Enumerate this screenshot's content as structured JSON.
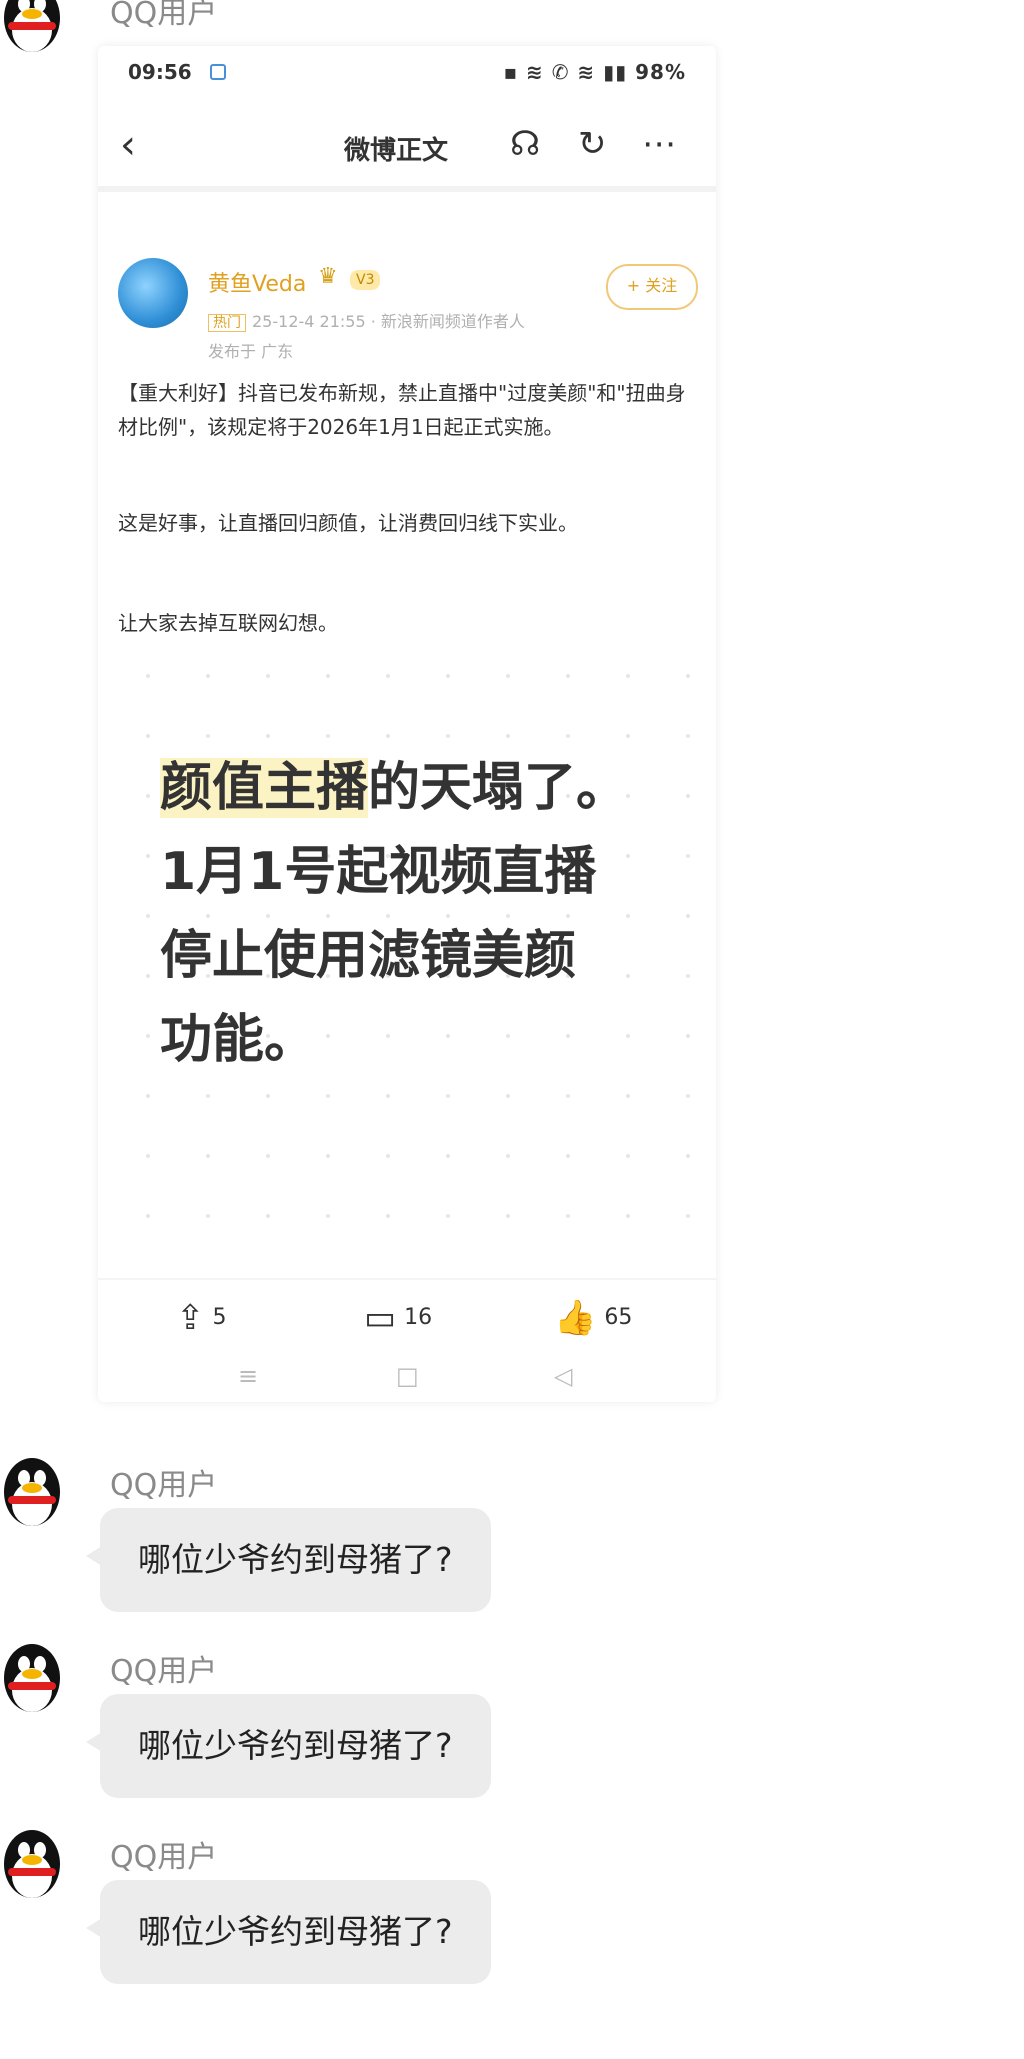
{
  "chat": {
    "messages": [
      {
        "sender": "QQ用户",
        "text": ""
      },
      {
        "sender": "QQ用户",
        "text": "哪位少爷约到母猪了?"
      },
      {
        "sender": "QQ用户",
        "text": "哪位少爷约到母猪了?"
      },
      {
        "sender": "QQ用户",
        "text": "哪位少爷约到母猪了?"
      }
    ]
  },
  "screenshot": {
    "status": {
      "time": "09:56",
      "right": "▪ ≋ ✆ ≋ ▮▮ 98%"
    },
    "nav": {
      "back": "‹",
      "title": "微博正文"
    },
    "post": {
      "author": "黄鱼Veda",
      "level": "V3",
      "tag": "热门",
      "meta": "25-12-4 21:55 · 新浪新闻频道作者人",
      "location": "发布于 广东",
      "follow": "+ 关注",
      "p1": "【重大利好】抖音已发布新规，禁止直播中\"过度美颜\"和\"扭曲身材比例\"，该规定将于2026年1月1日起正式实施。",
      "p2": "这是好事，让直播回归颜值，让消费回归线下实业。",
      "p3": "让大家去掉互联网幻想。",
      "image_text_hl": "颜值主播",
      "image_text_rest": "的天塌了。",
      "image_text_line2": "1月1号起视频直播",
      "image_text_line3": "停止使用滤镜美颜",
      "image_text_line4": "功能。"
    },
    "actions": {
      "repost": "5",
      "comment": "16",
      "like": "65"
    }
  }
}
